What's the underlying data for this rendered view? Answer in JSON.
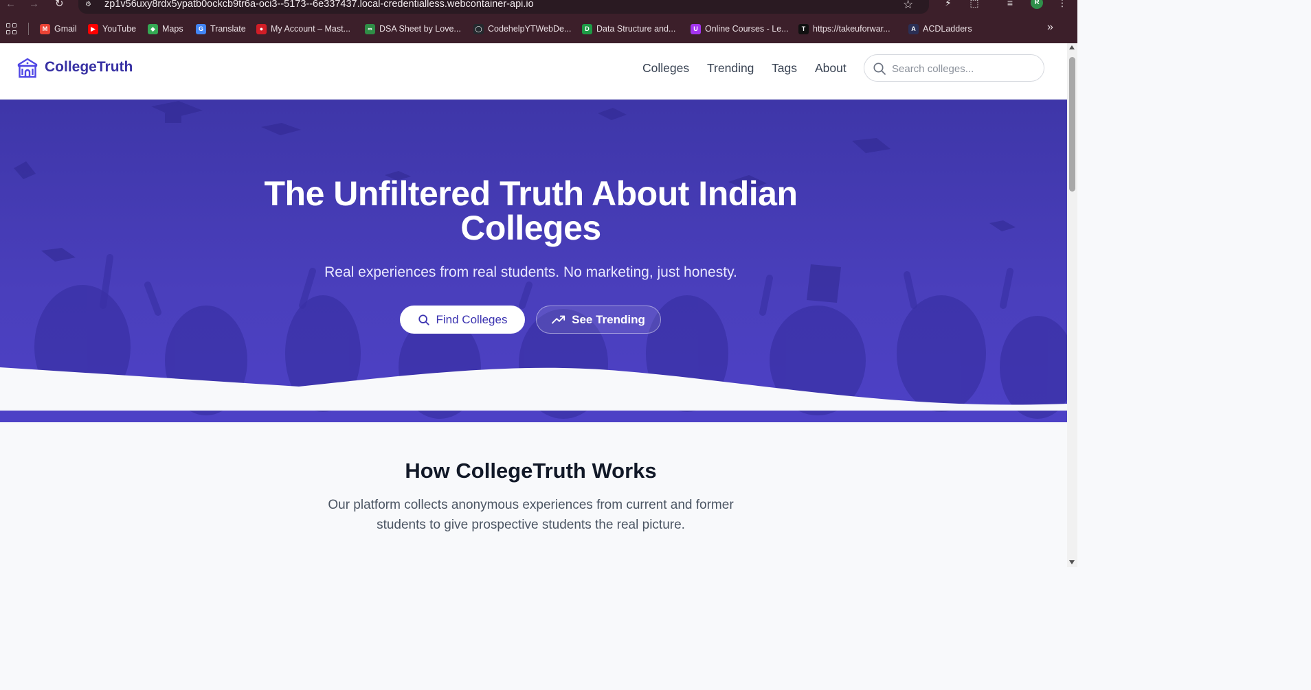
{
  "browser": {
    "url": "zp1v56uxy8rdx5ypatb0ockcb9tr6a-oci3--5173--6e337437.local-credentialless.webcontainer-api.io",
    "profile_initial": "R",
    "bookmarks": [
      {
        "label": "Gmail",
        "icon": "gmail-icon",
        "color": "#ea4335"
      },
      {
        "label": "YouTube",
        "icon": "youtube-icon",
        "color": "#ff0000"
      },
      {
        "label": "Maps",
        "icon": "maps-icon",
        "color": "#34a853"
      },
      {
        "label": "Translate",
        "icon": "translate-icon",
        "color": "#4285f4"
      },
      {
        "label": "My Account – Mast...",
        "icon": "mastercard-icon",
        "color": "#d11d26"
      },
      {
        "label": "DSA Sheet by Love...",
        "icon": "gfg-icon",
        "color": "#2f8d46"
      },
      {
        "label": "CodehelpYTWebDe...",
        "icon": "github-icon",
        "color": "#24292e"
      },
      {
        "label": "Data Structure and...",
        "icon": "data-structure-icon",
        "color": "#1d9b46"
      },
      {
        "label": "Online Courses - Le...",
        "icon": "udemy-icon",
        "color": "#a435f0"
      },
      {
        "label": "https://takeuforwar...",
        "icon": "tuf-icon",
        "color": "#111111"
      },
      {
        "label": "ACDLadders",
        "icon": "acd-icon",
        "color": "#2b2f55"
      }
    ]
  },
  "site": {
    "brand": "CollegeTruth",
    "brand_color": "#3730a3",
    "nav": [
      "Colleges",
      "Trending",
      "Tags",
      "About"
    ],
    "search_placeholder": "Search colleges..."
  },
  "hero": {
    "title_line1": "The Unfiltered Truth About Indian",
    "title_line2": "Colleges",
    "subtitle": "Real experiences from real students. No marketing, just honesty.",
    "primary_button": "Find Colleges",
    "secondary_button": "See Trending",
    "accent": "#4a3fbc"
  },
  "how": {
    "title": "How CollegeTruth Works",
    "line1": "Our platform collects anonymous experiences from current and former",
    "line2": "students to give prospective students the real picture."
  }
}
